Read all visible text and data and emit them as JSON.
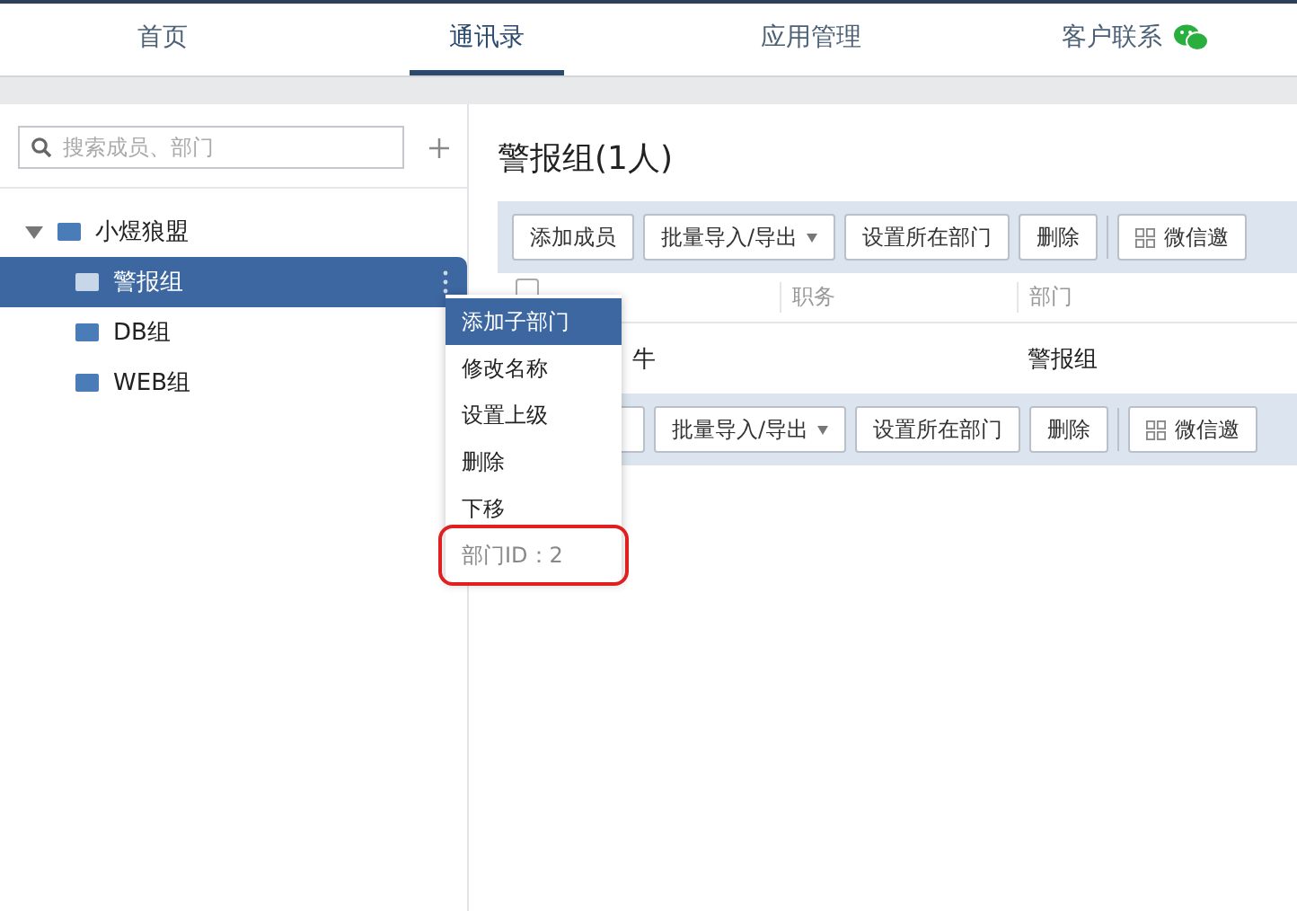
{
  "nav": {
    "tabs": [
      {
        "label": "首页",
        "selected": false,
        "wechat": false
      },
      {
        "label": "通讯录",
        "selected": true,
        "wechat": false
      },
      {
        "label": "应用管理",
        "selected": false,
        "wechat": false
      },
      {
        "label": "客户联系",
        "selected": false,
        "wechat": true
      }
    ]
  },
  "sidebar": {
    "search": {
      "placeholder": "搜索成员、部门"
    },
    "tree": [
      {
        "label": "小煜狼盟",
        "expanded": true,
        "selected": false,
        "children": [
          {
            "label": "警报组",
            "selected": true
          },
          {
            "label": "DB组",
            "selected": false
          },
          {
            "label": "WEB组",
            "selected": false
          }
        ]
      }
    ]
  },
  "context_menu": {
    "items": [
      {
        "label": "添加子部门",
        "selected": true,
        "disabled": false,
        "annotated": false
      },
      {
        "label": "修改名称",
        "selected": false,
        "disabled": false,
        "annotated": false
      },
      {
        "label": "设置上级",
        "selected": false,
        "disabled": false,
        "annotated": false
      },
      {
        "label": "删除",
        "selected": false,
        "disabled": false,
        "annotated": false
      },
      {
        "label": "下移",
        "selected": false,
        "disabled": false,
        "annotated": false
      },
      {
        "label": "部门ID：2",
        "selected": false,
        "disabled": true,
        "annotated": true
      }
    ]
  },
  "main": {
    "title": "警报组(1人)",
    "toolbar_top": [
      {
        "label": "添加成员",
        "kind": "plain"
      },
      {
        "label": "批量导入/导出",
        "kind": "dropdown"
      },
      {
        "label": "设置所在部门",
        "kind": "plain"
      },
      {
        "label": "删除",
        "kind": "plain"
      },
      {
        "label": "微信邀",
        "kind": "wechat"
      }
    ],
    "table": {
      "select_all_checked": false,
      "columns": [
        "",
        "职务",
        "部门"
      ],
      "rows": [
        [
          "牛",
          "",
          "警报组"
        ]
      ]
    },
    "toolbar_bottom": [
      {
        "kind": "plain"
      },
      {
        "label": "批量导入/导出",
        "kind": "dropdown"
      },
      {
        "label": "设置所在部门",
        "kind": "plain"
      },
      {
        "label": "删除",
        "kind": "plain"
      },
      {
        "label": "微信邀",
        "kind": "wechat"
      }
    ]
  }
}
